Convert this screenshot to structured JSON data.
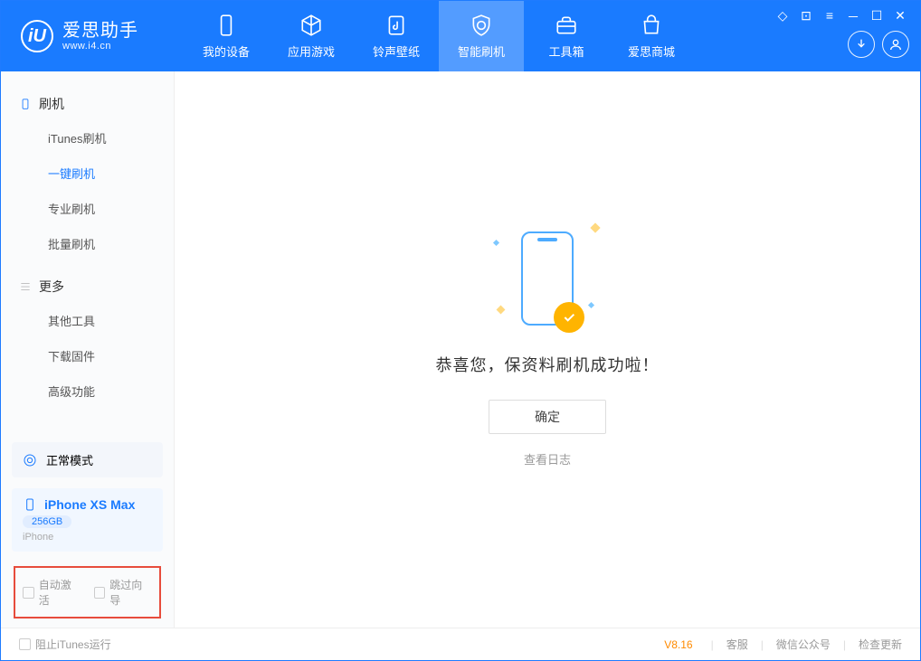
{
  "app": {
    "title": "爱思助手",
    "subtitle": "www.i4.cn"
  },
  "tabs": {
    "device": "我的设备",
    "apps": "应用游戏",
    "ringtone": "铃声壁纸",
    "flash": "智能刷机",
    "toolbox": "工具箱",
    "store": "爱思商城"
  },
  "sidebar": {
    "section1_title": "刷机",
    "items1": {
      "itunes": "iTunes刷机",
      "oneclick": "一键刷机",
      "pro": "专业刷机",
      "batch": "批量刷机"
    },
    "section2_title": "更多",
    "items2": {
      "other": "其他工具",
      "firmware": "下载固件",
      "advanced": "高级功能"
    }
  },
  "device_panel": {
    "mode": "正常模式",
    "name": "iPhone XS Max",
    "capacity": "256GB",
    "type": "iPhone"
  },
  "bottom_checks": {
    "auto_activate": "自动激活",
    "skip_wizard": "跳过向导"
  },
  "main": {
    "success_msg": "恭喜您，保资料刷机成功啦！",
    "ok_button": "确定",
    "view_log": "查看日志"
  },
  "footer": {
    "block_itunes": "阻止iTunes运行",
    "version": "V8.16",
    "support": "客服",
    "wechat": "微信公众号",
    "update": "检查更新"
  }
}
